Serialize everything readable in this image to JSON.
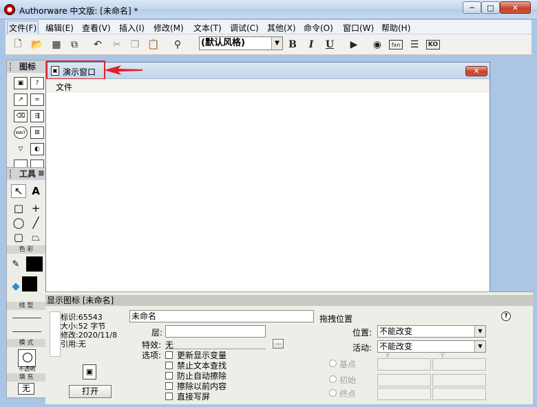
{
  "window": {
    "title": "Authorware 中文版: [未命名] *",
    "controls": {
      "minimize": "─",
      "maximize": "□",
      "close": "✕"
    }
  },
  "menubar": [
    "文件(F)",
    "编辑(E)",
    "查看(V)",
    "插入(I)",
    "修改(M)",
    "文本(T)",
    "调试(C)",
    "其他(X)",
    "命令(O)",
    "窗口(W)",
    "帮助(H)"
  ],
  "toolbar": {
    "style_select": "(默认风格)",
    "bold": "B",
    "italic": "I",
    "underline": "U",
    "fn_label": "fxn",
    "ko_label": "KO"
  },
  "icons_panel": {
    "title": "图标",
    "wait_label": "WAIT"
  },
  "tools_panel": {
    "title": "工具",
    "color_label": "色 彩",
    "line_label": "线 型",
    "mode_label": "模 式",
    "mode_value": "不透明",
    "fill_label": "填 充",
    "fill_value": "无"
  },
  "presentation": {
    "title": "演示窗口",
    "menu_file": "文件"
  },
  "properties": {
    "header": "显示图标 [未命名]",
    "id_label": "标识:65543",
    "size_label": "大小:52 字节",
    "modified_label": "修改:2020/11/8",
    "ref_label": "引用:无",
    "open_button": "打开",
    "name_value": "未命名",
    "layer_label": "层:",
    "effect_label": "特效:",
    "effect_value": "无",
    "effect_btn": "...",
    "options_label": "选项:",
    "options": [
      "更新显示变量",
      "禁止文本查找",
      "防止自动擦除",
      "擦除以前内容",
      "直接写屏"
    ],
    "pick_position": "拖拽位置",
    "position_label": "位置:",
    "position_value": "不能改变",
    "motion_label": "活动:",
    "motion_value": "不能改变",
    "base_label": "基点",
    "initial_label": "初始",
    "end_label": "终点",
    "x_label": "X",
    "y_label": "Y",
    "help": "?"
  },
  "colors": {
    "highlight": "#e0212b",
    "titlebar": "#c2d6ee",
    "workarea": "#aac6e4"
  }
}
